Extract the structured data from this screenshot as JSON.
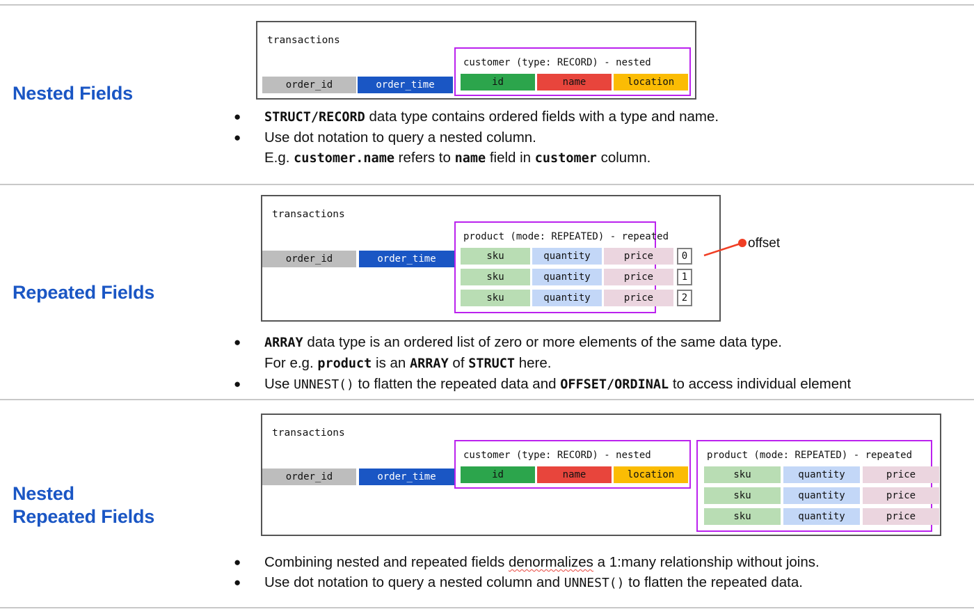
{
  "page": {
    "title": "BigQuery Nested and Repeated Fields",
    "accent_color": "#1a56c4",
    "group_border_color": "#bb22ee",
    "divider_color": "#c8c8c8"
  },
  "sections": [
    {
      "title": "Nested Fields",
      "diagram": {
        "table_name": "transactions",
        "plain_columns": [
          {
            "label": "order_id",
            "color": "#bdbdbd"
          },
          {
            "label": "order_time",
            "color": "#1a56c4"
          }
        ],
        "groups": [
          {
            "label": "customer (type: RECORD) - nested",
            "kind": "nested",
            "fields": [
              {
                "label": "id",
                "color": "#2ca54c"
              },
              {
                "label": "name",
                "color": "#e8453c"
              },
              {
                "label": "location",
                "color": "#fbbc04"
              }
            ]
          }
        ]
      },
      "bullets": [
        {
          "main_prefix_code": "STRUCT/RECORD",
          "main_rest": " data type contains ordered fields with a type and name."
        },
        {
          "main_plain": "Use dot notation to query a nested column.",
          "sub": {
            "pre": "E.g. ",
            "code1": "customer.name",
            "mid1": " refers to ",
            "code2": "name",
            "mid2": " field in ",
            "code3": "customer",
            "post": " column."
          }
        }
      ]
    },
    {
      "title": "Repeated Fields",
      "diagram": {
        "table_name": "transactions",
        "plain_columns": [
          {
            "label": "order_id",
            "color": "#bdbdbd"
          },
          {
            "label": "order_time",
            "color": "#1a56c4"
          }
        ],
        "groups": [
          {
            "label": "product (mode: REPEATED) - repeated",
            "kind": "repeated",
            "row_fields": [
              {
                "label": "sku",
                "color": "#b9ddb4"
              },
              {
                "label": "quantity",
                "color": "#c3d7f7"
              },
              {
                "label": "price",
                "color": "#ebd5df"
              }
            ],
            "offsets": [
              "0",
              "1",
              "2"
            ]
          }
        ],
        "callout": {
          "label": "offset",
          "color": "#f03e24"
        }
      },
      "bullets": [
        {
          "main_prefix_code": "ARRAY",
          "main_rest": " data type is an ordered list of zero or more elements of the same data type.",
          "sub": {
            "pre": "For e.g. ",
            "code1": "product",
            "mid1": " is an ",
            "code2": "ARRAY",
            "mid2": " of ",
            "code3": "STRUCT",
            "post": " here."
          }
        },
        {
          "mixed": {
            "pre": "Use ",
            "code1": "UNNEST()",
            "mid1": " to flatten the repeated data and ",
            "code2": "OFFSET/ORDINAL",
            "post": " to access individual element"
          }
        }
      ]
    },
    {
      "title": "Nested\nRepeated Fields",
      "diagram": {
        "table_name": "transactions",
        "plain_columns": [
          {
            "label": "order_id",
            "color": "#bdbdbd"
          },
          {
            "label": "order_time",
            "color": "#1a56c4"
          }
        ],
        "groups": [
          {
            "label": "customer (type: RECORD) - nested",
            "kind": "nested",
            "fields": [
              {
                "label": "id",
                "color": "#2ca54c"
              },
              {
                "label": "name",
                "color": "#e8453c"
              },
              {
                "label": "location",
                "color": "#fbbc04"
              }
            ]
          },
          {
            "label": "product (mode: REPEATED) - repeated",
            "kind": "repeated",
            "row_fields": [
              {
                "label": "sku",
                "color": "#b9ddb4"
              },
              {
                "label": "quantity",
                "color": "#c3d7f7"
              },
              {
                "label": "price",
                "color": "#ebd5df"
              }
            ],
            "rows": 3
          }
        ]
      },
      "bullets": [
        {
          "combined": {
            "pre": "Combining nested and repeated fields ",
            "misspelled": "denormalizes",
            "post": " a 1:many relationship without joins."
          }
        },
        {
          "mixed": {
            "pre": "Use dot notation to query a nested column and ",
            "code1": "UNNEST()",
            "post": " to flatten the repeated data."
          }
        }
      ]
    }
  ],
  "bullet_glyph": "●"
}
